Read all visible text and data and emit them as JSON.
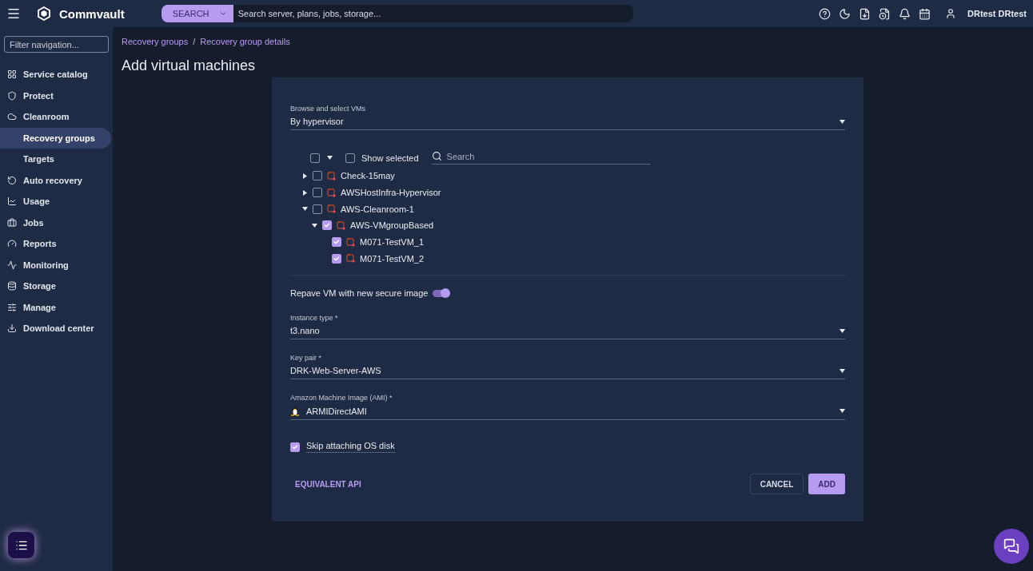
{
  "header": {
    "brand": "Commvault",
    "search_scope": "SEARCH",
    "search_placeholder": "Search server, plans, jobs, storage...",
    "user": "DRtest DRtest"
  },
  "sidebar": {
    "filter_placeholder": "Filter navigation...",
    "items": [
      {
        "label": "Service catalog",
        "selected": false
      },
      {
        "label": "Protect",
        "selected": false
      },
      {
        "label": "Cleanroom",
        "selected": false,
        "children": [
          {
            "label": "Recovery groups",
            "selected": true
          },
          {
            "label": "Targets",
            "selected": false
          }
        ]
      },
      {
        "label": "Auto recovery",
        "selected": false
      },
      {
        "label": "Usage",
        "selected": false
      },
      {
        "label": "Jobs",
        "selected": false
      },
      {
        "label": "Reports",
        "selected": false
      },
      {
        "label": "Monitoring",
        "selected": false
      },
      {
        "label": "Storage",
        "selected": false
      },
      {
        "label": "Manage",
        "selected": false
      },
      {
        "label": "Download center",
        "selected": false
      }
    ]
  },
  "breadcrumbs": [
    "Recovery groups",
    "Recovery group details"
  ],
  "breadcrumb_separator": "/",
  "page_title": "Add virtual machines",
  "form": {
    "browse": {
      "label": "Browse and select VMs",
      "value": "By hypervisor"
    },
    "tree": {
      "select_all_checked": false,
      "show_selected": {
        "label": "Show selected",
        "checked": false
      },
      "search_placeholder": "Search",
      "nodes": [
        {
          "label": "Check-15may",
          "checked": false,
          "expanded": false
        },
        {
          "label": "AWSHostInfra-Hypervisor",
          "checked": false,
          "expanded": false
        },
        {
          "label": "AWS-Cleanroom-1",
          "checked": false,
          "expanded": true,
          "children": [
            {
              "label": "AWS-VMgroupBased",
              "checked": true,
              "expanded": true,
              "children": [
                {
                  "label": "M071-TestVM_1",
                  "checked": true
                },
                {
                  "label": "M071-TestVM_2",
                  "checked": true
                }
              ]
            }
          ]
        }
      ]
    },
    "repave": {
      "label": "Repave VM with new secure image",
      "on": true
    },
    "fields": [
      {
        "kind": "select",
        "label": "Instance type *",
        "value": "t3.nano"
      },
      {
        "kind": "select",
        "label": "Key pair *",
        "value": "DRK-Web-Server-AWS"
      },
      {
        "kind": "os-select",
        "label": "Amazon Machine Image (AMI) *",
        "value": "ARMIDirectAMI"
      }
    ],
    "skip_os_disk": {
      "label": "Skip attaching OS disk",
      "checked": true
    },
    "buttons": {
      "api": "EQUIVALENT API",
      "cancel": "CANCEL",
      "add": "ADD"
    }
  }
}
